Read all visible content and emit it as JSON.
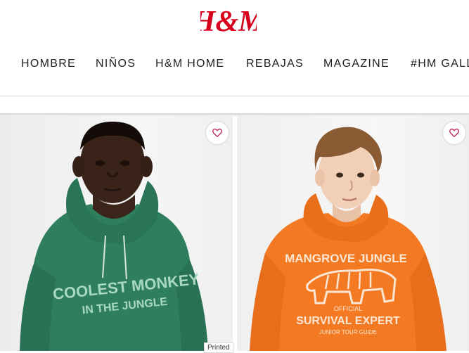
{
  "brand": {
    "logo_text": "H&M",
    "logo_color": "#d6001c"
  },
  "nav": {
    "items": [
      {
        "label": "HOMBRE"
      },
      {
        "label": "NIÑOS"
      },
      {
        "label": "H&M HOME"
      },
      {
        "label": "REBAJAS"
      },
      {
        "label": "MAGAZINE"
      },
      {
        "label": "#HM GALLERY"
      }
    ]
  },
  "products": [
    {
      "image": "boy-in-green-hoodie",
      "hoodie_color": "#2f7f5f",
      "print_lines": [
        "COOLEST MONKEY",
        "IN THE JUNGLE"
      ],
      "favorite_icon": "heart-outline-icon",
      "tag": "Printed"
    },
    {
      "image": "boy-in-orange-hoodie",
      "hoodie_color": "#f37a23",
      "print_lines": [
        "MANGROVE JUNGLE",
        "OFFICIAL",
        "SURVIVAL EXPERT",
        "JUNIOR TOUR GUIDE"
      ],
      "favorite_icon": "heart-outline-icon"
    }
  ],
  "colors": {
    "heart": "#c0245c",
    "nav_text": "#222222"
  }
}
